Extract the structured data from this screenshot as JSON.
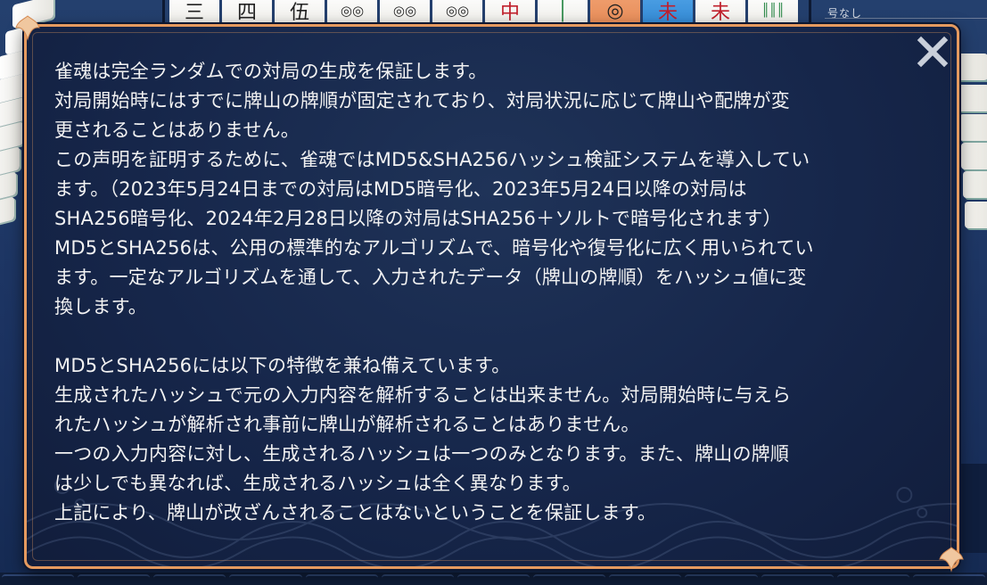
{
  "top_tiles": [
    {
      "glyph": "三",
      "style": "plain"
    },
    {
      "glyph": "四",
      "style": "plain"
    },
    {
      "glyph": "伍",
      "style": "plain"
    },
    {
      "glyph": "◎◎",
      "style": "plain"
    },
    {
      "glyph": "◎◎",
      "style": "plain"
    },
    {
      "glyph": "◎◎",
      "style": "plain"
    },
    {
      "glyph": "中",
      "style": "red"
    },
    {
      "glyph": "│",
      "style": "green"
    },
    {
      "glyph": "◎",
      "style": "orange"
    },
    {
      "glyph": "未",
      "style": "blue"
    },
    {
      "glyph": "未",
      "style": "plain"
    },
    {
      "glyph": "║║║",
      "style": "green"
    }
  ],
  "hud": {
    "label": "号なし"
  },
  "dialog": {
    "close_label": "×",
    "paragraphs": [
      "雀魂は完全ランダムでの対局の生成を保証します。",
      "対局開始時にはすでに牌山の牌順が固定されており、対局状況に応じて牌山や配牌が変",
      "更されることはありません。",
      "この声明を証明するために、雀魂ではMD5&SHA256ハッシュ検証システムを導入してい",
      "ます。（2023年5月24日までの対局はMD5暗号化、2023年5月24日以降の対局は",
      "SHA256暗号化、2024年2月28日以降の対局はSHA256＋ソルトで暗号化されます）",
      "MD5とSHA256は、公用の標準的なアルゴリズムで、暗号化や復号化に広く用いられてい",
      "ます。一定なアルゴリズムを通して、入力されたデータ（牌山の牌順）をハッシュ値に変",
      "換します。",
      "",
      "MD5とSHA256には以下の特徴を兼ね備えています。",
      "生成されたハッシュで元の入力内容を解析することは出来ません。対局開始時に与えら",
      "れたハッシュが解析され事前に牌山が解析されることはありません。",
      "一つの入力内容に対し、生成されるハッシュは一つのみとなります。また、牌山の牌順",
      "は少しでも異なれば、生成されるハッシュは全く異なります。",
      "上記により、牌山が改ざんされることはないということを保証します。"
    ]
  },
  "colors": {
    "dialog_border": "#e59a5f",
    "dialog_bg": "#16264a",
    "text": "#f2f2f2",
    "close_icon": "#c9cfda"
  },
  "icons": {
    "close": "close-icon",
    "corner": "sakura-corner-icon"
  }
}
